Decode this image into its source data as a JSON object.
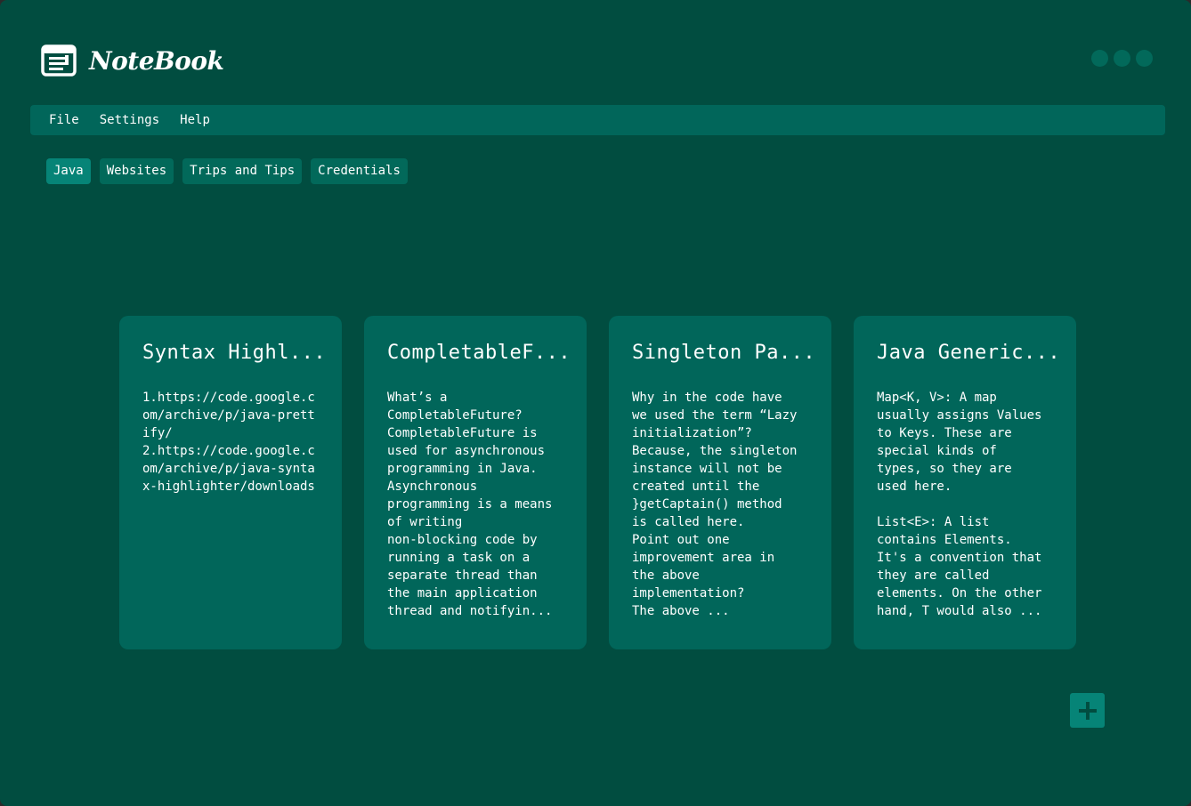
{
  "app": {
    "title": "NoteBook"
  },
  "menu": {
    "items": [
      "File",
      "Settings",
      "Help"
    ]
  },
  "tabs": [
    {
      "label": "Java",
      "active": true
    },
    {
      "label": "Websites",
      "active": false
    },
    {
      "label": "Trips and Tips",
      "active": false
    },
    {
      "label": "Credentials",
      "active": false
    }
  ],
  "notes": [
    {
      "title": "Syntax Highl...",
      "body": "1.https://code.google.com/archive/p/java-prettify/\n2.https://code.google.com/archive/p/java-syntax-highlighter/downloads"
    },
    {
      "title": "CompletableF...",
      "body": "What’s a\nCompletableFuture?\nCompletableFuture is\nused for asynchronous\nprogramming in Java.\nAsynchronous\nprogramming is a means\nof writing\nnon-blocking code by\nrunning a task on a\nseparate thread than\nthe main application\nthread and notifyin..."
    },
    {
      "title": "Singleton Pa...",
      "body": "Why in the code have\nwe used the term “Lazy\ninitialization”?\nBecause, the singleton\ninstance will not be\ncreated until the\n}getCaptain() method\nis called here.\nPoint out one\nimprovement area in\nthe above\nimplementation?\nThe above ..."
    },
    {
      "title": "Java Generic...",
      "body": "Map<K, V>: A map\nusually assigns Values\nto Keys. These are\nspecial kinds of\ntypes, so they are\nused here.\n\nList<E>: A list\ncontains Elements.\nIt's a convention that\nthey are called\nelements. On the other\nhand, T would also ..."
    }
  ],
  "colors": {
    "background": "#014d40",
    "surface": "#01665a",
    "accent": "#068477",
    "text": "#ffffff"
  },
  "icons": {
    "logo": "notebook-icon",
    "add": "plus-icon"
  }
}
